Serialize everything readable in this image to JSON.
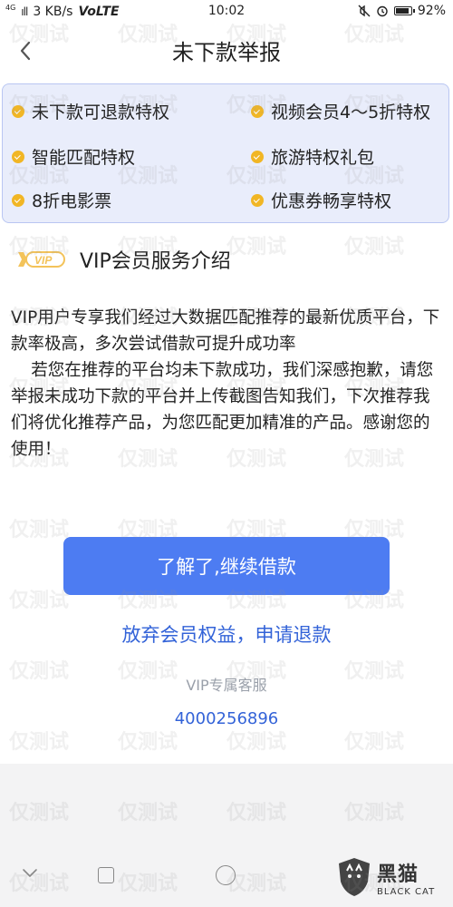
{
  "status_bar": {
    "network_small": "4G",
    "signal_text": "ıll",
    "speed": "3 KB/s",
    "volte": "VoLTE",
    "time": "10:02",
    "battery": "92%",
    "battery_level": 0.92
  },
  "header": {
    "back_icon": "chevron-left-icon",
    "title": "未下款举报"
  },
  "privileges": [
    {
      "label": "未下款可退款特权"
    },
    {
      "label": "视频会员4～5折特权"
    },
    {
      "label": "智能匹配特权"
    },
    {
      "label": "旅游特权礼包"
    },
    {
      "label": "8折电影票"
    },
    {
      "label": "优惠券畅享特权"
    }
  ],
  "vip_section": {
    "logo_text": "VIP",
    "title": "VIP会员服务介绍",
    "paragraph1": "VIP用户专享我们经过大数据匹配推荐的最新优质平台，下款率极高，多次尝试借款可提升成功率",
    "paragraph2": "若您在推荐的平台均未下款成功，我们深感抱歉，请您举报未成功下款的平台并上传截图告知我们，下次推荐我们将优化推荐产品，为您匹配更加精准的产品。感谢您的使用！"
  },
  "actions": {
    "continue_label": "了解了,继续借款",
    "refund_label": "放弃会员权益，申请退款"
  },
  "service": {
    "label": "VIP专属客服",
    "phone": "4000256896"
  },
  "watermark": {
    "text": "仅测试"
  },
  "blackcat": {
    "cn": "黑猫",
    "en": "BLACK CAT"
  },
  "colors": {
    "accent": "#4d7cf2",
    "link": "#3363d8",
    "panel_bg": "#e9edfb",
    "check": "#f1b625"
  }
}
